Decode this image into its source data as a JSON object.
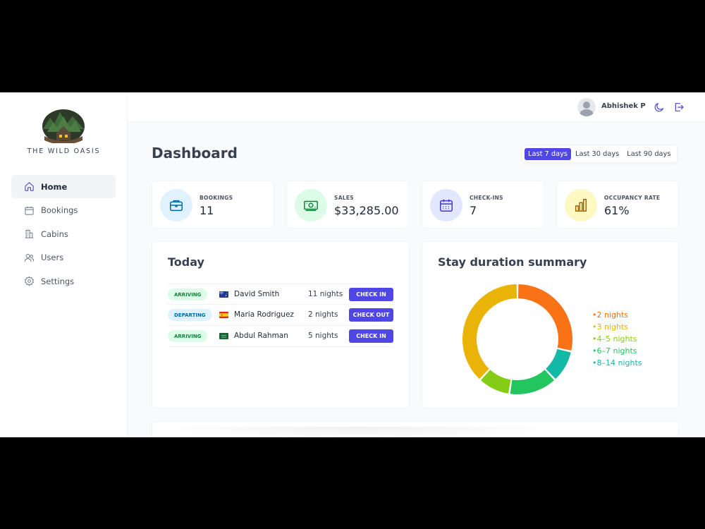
{
  "sidebar": {
    "logo_text": "THE WILD OASIS",
    "items": [
      {
        "label": "Home",
        "icon": "home-icon",
        "active": true
      },
      {
        "label": "Bookings",
        "icon": "calendar-icon"
      },
      {
        "label": "Cabins",
        "icon": "buildings-icon"
      },
      {
        "label": "Users",
        "icon": "users-icon"
      },
      {
        "label": "Settings",
        "icon": "gear-icon"
      }
    ]
  },
  "header": {
    "user_name": "Abhishek P",
    "icons": [
      "moon-icon",
      "logout-icon"
    ]
  },
  "main": {
    "title": "Dashboard",
    "filters": [
      {
        "label": "Last 7 days",
        "active": true
      },
      {
        "label": "Last 30 days"
      },
      {
        "label": "Last 90 days"
      }
    ],
    "stats": [
      {
        "label": "BOOKINGS",
        "value": "11",
        "icon": "briefcase-icon",
        "icon_bg": "#e0f2fe",
        "icon_color": "#0369a1"
      },
      {
        "label": "SALES",
        "value": "$33,285.00",
        "icon": "banknotes-icon",
        "icon_bg": "#dcfce7",
        "icon_color": "#15803d"
      },
      {
        "label": "CHECK-INS",
        "value": "7",
        "icon": "calendar-days-icon",
        "icon_bg": "#e0e7ff",
        "icon_color": "#4338ca"
      },
      {
        "label": "OCCUPANCY RATE",
        "value": "61%",
        "icon": "chart-bar-icon",
        "icon_bg": "#fef9c3",
        "icon_color": "#a16207"
      }
    ],
    "today": {
      "title": "Today",
      "rows": [
        {
          "status": "ARRIVING",
          "status_color": "green",
          "flag": "australia-flag-icon",
          "guest": "David Smith",
          "nights": "11 nights",
          "action": "CHECK IN"
        },
        {
          "status": "DEPARTING",
          "status_color": "blue",
          "flag": "spain-flag-icon",
          "guest": "Maria Rodriguez",
          "nights": "2 nights",
          "action": "CHECK OUT"
        },
        {
          "status": "ARRIVING",
          "status_color": "green",
          "flag": "saudi-arabia-flag-icon",
          "guest": "Abdul Rahman",
          "nights": "5 nights",
          "action": "CHECK IN"
        }
      ]
    },
    "stay_summary": {
      "title": "Stay duration summary"
    }
  },
  "chart_data": {
    "type": "pie",
    "title": "Stay duration summary",
    "categories": [
      "2 nights",
      "3 nights",
      "4-5 nights",
      "6-7 nights",
      "8-14 nights"
    ],
    "legend_labels": [
      "2 nights",
      "3 nights",
      "4–5 nights",
      "6–7 nights",
      "8–14 nights"
    ],
    "values": [
      3,
      4,
      1,
      1.5,
      1
    ],
    "colors": [
      "#f97316",
      "#eab308",
      "#84cc16",
      "#22c55e",
      "#14b8a6"
    ],
    "draw_order": [
      0,
      4,
      3,
      2,
      1
    ],
    "donut": true,
    "legend_position": "right"
  }
}
